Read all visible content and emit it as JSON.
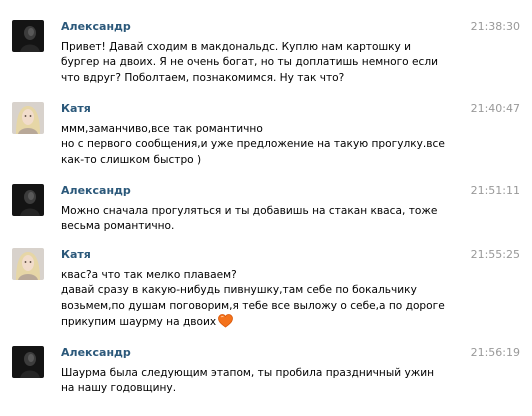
{
  "colors": {
    "author": "#2b587a",
    "time": "#999999",
    "heart": "#f4721b"
  },
  "messages": [
    {
      "author": "Александр",
      "time": "21:38:30",
      "avatar": "dark-avatar",
      "lines": [
        "Привет! Давай сходим в макдональдс. Куплю нам картошку и",
        "бургер на двоих. Я не очень богат, но ты доплатишь немного если",
        "что вдруг? Поболтаем, познакомимся. Ну так что?"
      ]
    },
    {
      "author": "Катя",
      "time": "21:40:47",
      "avatar": "blonde-avatar",
      "lines": [
        "ммм,заманчиво,все так романтично",
        "но с первого сообщения,и уже предложение на такую прогулку.все",
        "как-то слишком быстро )"
      ]
    },
    {
      "author": "Александр",
      "time": "21:51:11",
      "avatar": "dark-avatar",
      "lines": [
        "Можно сначала прогуляться и ты добавишь на стакан кваса, тоже",
        "весьма романтично."
      ]
    },
    {
      "author": "Катя",
      "time": "21:55:25",
      "avatar": "blonde-avatar",
      "lines": [
        "квас?а что так мелко плаваем?",
        "давай сразу в какую-нибудь пивнушку,там себе по бокальчику",
        "возьмем,по душам поговорим,я тебе все выложу о себе,а по дороге",
        "прикупим шаурму на двоих"
      ]
    },
    {
      "author": "Александр",
      "time": "21:56:19",
      "avatar": "dark-avatar",
      "lines": [
        "Шаурма была следующим этапом, ты пробила праздничный ужин",
        "на нашу годовщину."
      ]
    }
  ]
}
